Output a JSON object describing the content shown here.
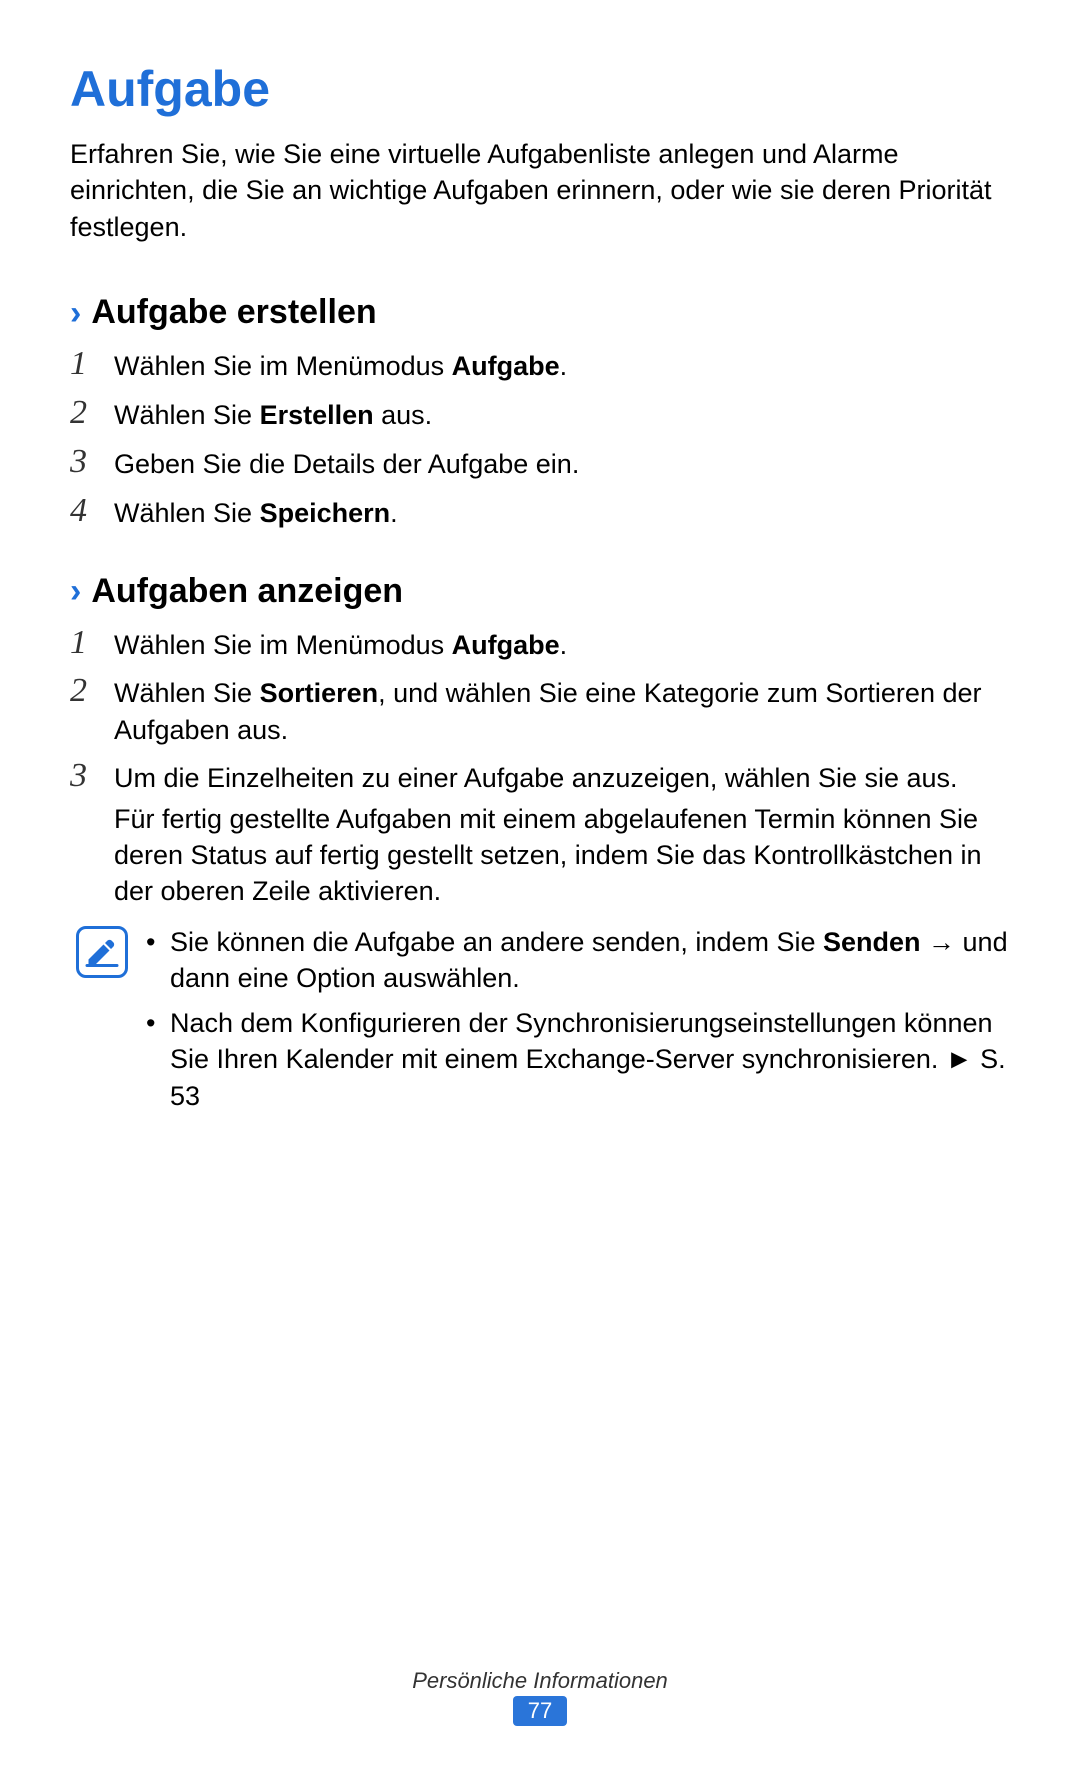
{
  "title": "Aufgabe",
  "intro": "Erfahren Sie, wie Sie eine virtuelle Aufgabenliste anlegen und Alarme einrichten, die Sie an wichtige Aufgaben erinnern, oder wie sie deren Priorität festlegen.",
  "section1": {
    "heading": "Aufgabe erstellen",
    "steps": {
      "n1": "1",
      "s1a": "Wählen Sie im Menümodus ",
      "s1b": "Aufgabe",
      "s1c": ".",
      "n2": "2",
      "s2a": "Wählen Sie ",
      "s2b": "Erstellen",
      "s2c": " aus.",
      "n3": "3",
      "s3": "Geben Sie die Details der Aufgabe ein.",
      "n4": "4",
      "s4a": "Wählen Sie ",
      "s4b": "Speichern",
      "s4c": "."
    }
  },
  "section2": {
    "heading": "Aufgaben anzeigen",
    "steps": {
      "n1": "1",
      "s1a": "Wählen Sie im Menümodus ",
      "s1b": "Aufgabe",
      "s1c": ".",
      "n2": "2",
      "s2a": "Wählen Sie ",
      "s2b": "Sortieren",
      "s2c": ", und wählen Sie eine Kategorie zum Sortieren der Aufgaben aus.",
      "n3": "3",
      "s3a": "Um die Einzelheiten zu einer Aufgabe anzuzeigen, wählen Sie sie aus.",
      "s3b": "Für fertig gestellte Aufgaben mit einem abgelaufenen Termin können Sie deren Status auf fertig gestellt setzen, indem Sie das Kontrollkästchen in der oberen Zeile aktivieren."
    }
  },
  "notes": {
    "b1a": "Sie können die Aufgabe an andere senden, indem Sie ",
    "b1b": "Senden",
    "b1c": " → und dann eine Option auswählen.",
    "b2a": "Nach dem Konfigurieren der Synchronisierungseinstellungen können Sie Ihren Kalender mit einem Exchange-Server synchronisieren. ► S. 53"
  },
  "footer": {
    "section": "Persönliche Informationen",
    "page": "77"
  },
  "glyphs": {
    "chevron": "›",
    "bullet": "•"
  }
}
